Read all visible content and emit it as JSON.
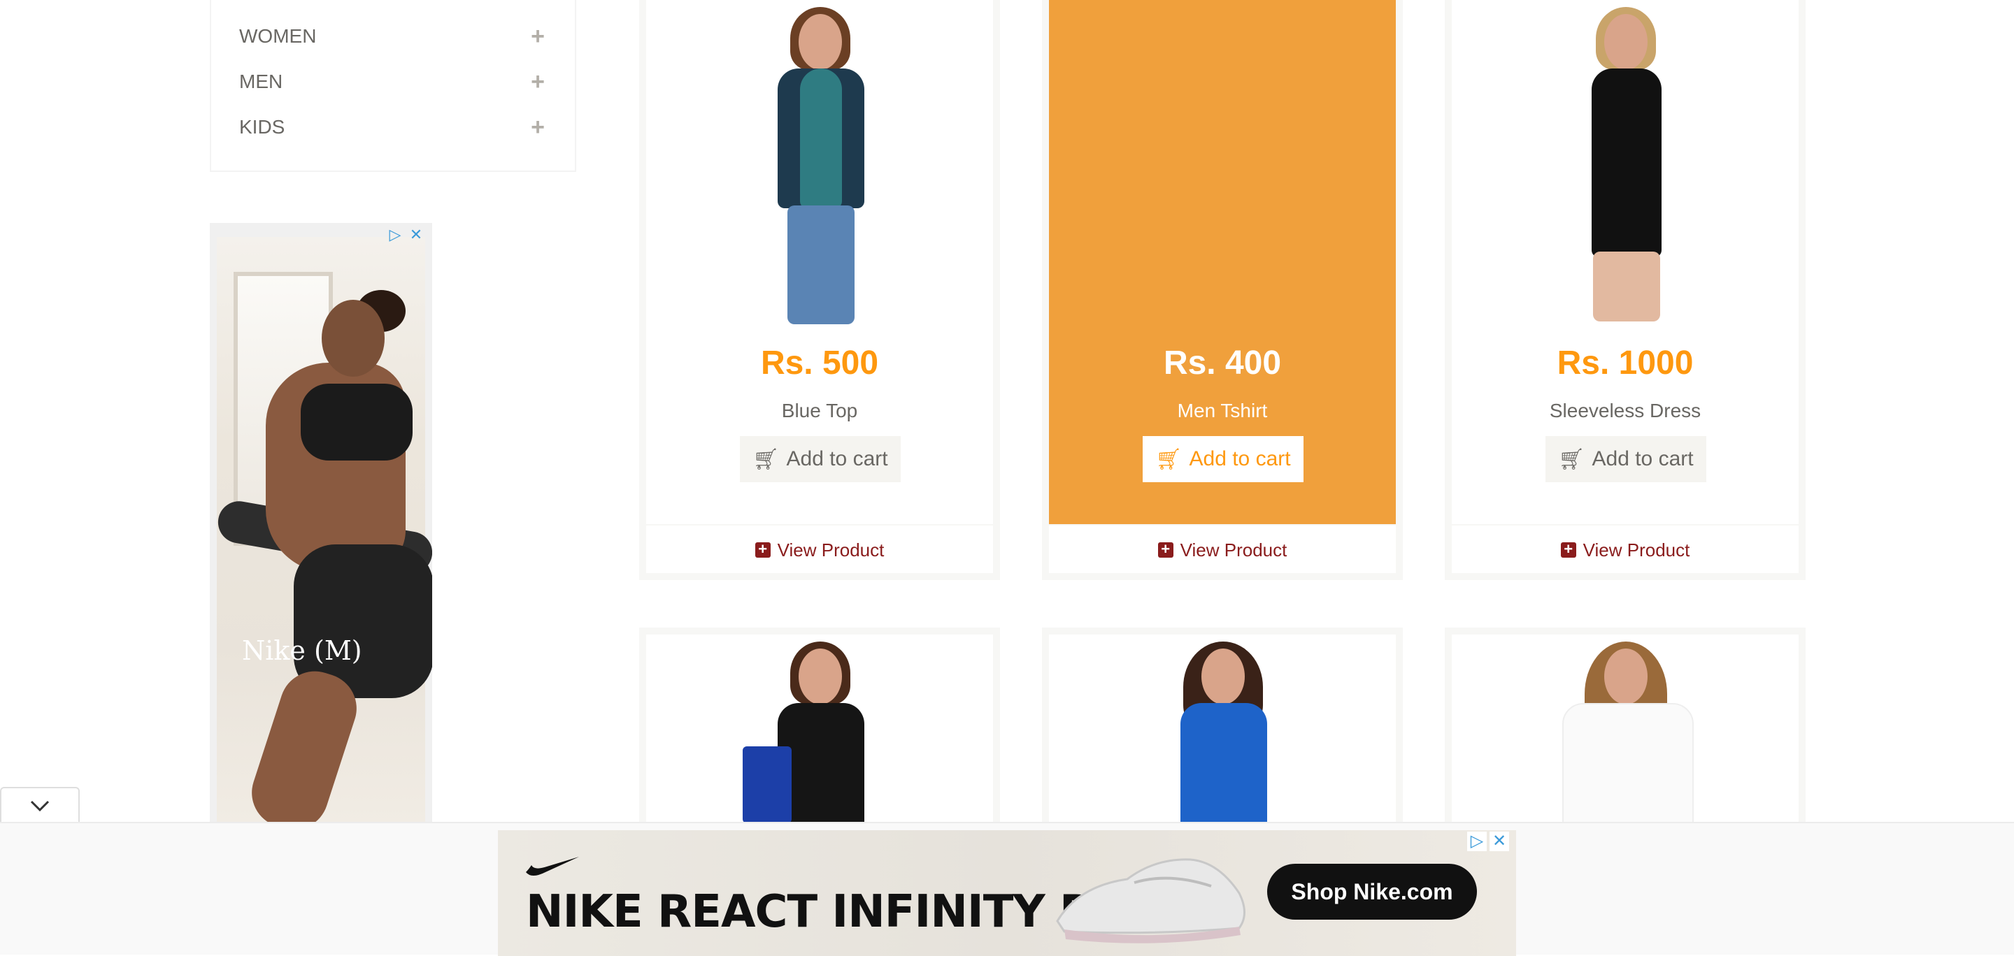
{
  "sidebar": {
    "categories": [
      {
        "label": "WOMEN",
        "toggle": "+"
      },
      {
        "label": "MEN",
        "toggle": "+"
      },
      {
        "label": "KIDS",
        "toggle": "+"
      }
    ]
  },
  "side_ad": {
    "logo_text": "Nike (M)",
    "adchoices_icon": "adchoices-icon",
    "close_icon": "close-icon"
  },
  "products": [
    {
      "price": "Rs. 500",
      "name": "Blue Top",
      "cart_label": "Add to cart",
      "view_label": "View Product",
      "hovered": false
    },
    {
      "price": "Rs. 400",
      "name": "Men Tshirt",
      "cart_label": "Add to cart",
      "view_label": "View Product",
      "hovered": true
    },
    {
      "price": "Rs. 1000",
      "name": "Sleeveless Dress",
      "cart_label": "Add to cart",
      "view_label": "View Product",
      "hovered": false
    }
  ],
  "bottom_ad": {
    "headline": "NIKE REACT INFINITY RUN 2",
    "cta": "Shop Nike.com",
    "collapse_icon": "chevron-down-icon"
  },
  "colors": {
    "accent": "#fe980f",
    "hover_overlay": "#f0a03c",
    "link": "#8a1c1c"
  }
}
